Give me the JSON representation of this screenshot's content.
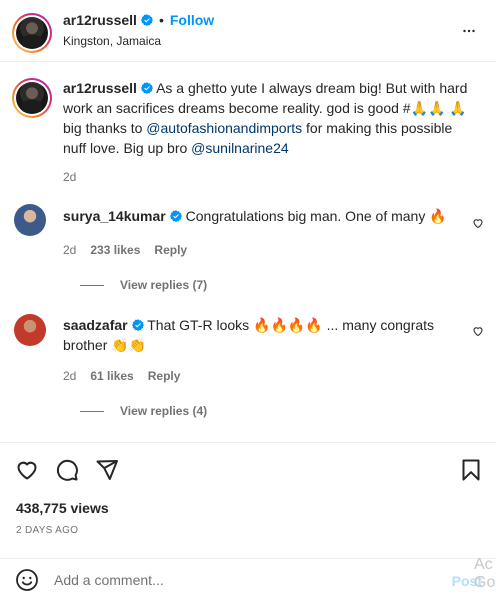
{
  "header": {
    "username": "ar12russell",
    "dot": "•",
    "follow_label": "Follow",
    "location": "Kingston, Jamaica",
    "more_icon": "more-horizontal-icon"
  },
  "caption": {
    "username": "ar12russell",
    "text_part1": "As a ghetto yute I always dream big! But with hard work an sacrifices dreams become reality. god is good #",
    "emoji_pray": "🙏🙏",
    "emoji_pray2": "🙏",
    "text_part2": " big thanks to ",
    "mention1": "@autofashionandimports",
    "text_part3": " for making this possible nuff love. Big up bro ",
    "mention2": "@sunilnarine24",
    "time": "2d"
  },
  "comments": [
    {
      "username": "surya_14kumar",
      "text": "Congratulations big man. One of many 🔥",
      "time": "2d",
      "likes": "233 likes",
      "reply_label": "Reply",
      "view_replies": "View replies (7)"
    },
    {
      "username": "saadzafar",
      "text": "That GT-R looks 🔥🔥🔥🔥 ... many congrats brother 👏👏",
      "time": "2d",
      "likes": "61 likes",
      "reply_label": "Reply",
      "view_replies": "View replies (4)"
    }
  ],
  "actions": {
    "views": "438,775 views",
    "date": "2 DAYS AGO"
  },
  "comment_box": {
    "placeholder": "Add a comment...",
    "post_label": "Post"
  },
  "overlay": {
    "text": "Ac Go"
  },
  "colors": {
    "accent": "#0095f6",
    "link": "#00376b",
    "secondary": "#737373",
    "post_disabled": "#b2dffc"
  }
}
